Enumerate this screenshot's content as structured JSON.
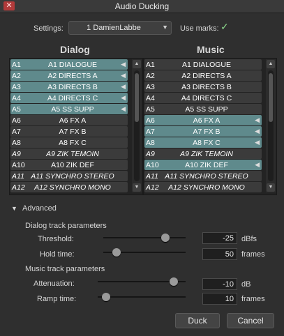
{
  "window": {
    "title": "Audio Ducking",
    "close": "✕"
  },
  "settings": {
    "label": "Settings:",
    "value": "1 DamienLabbe",
    "use_marks_label": "Use marks:",
    "use_marks_checked": true
  },
  "dialog": {
    "title": "Dialog",
    "tracks": [
      {
        "id": "A1",
        "name": "A1 DIALOGUE",
        "selected": true,
        "italic": false
      },
      {
        "id": "A2",
        "name": "A2 DIRECTS A",
        "selected": true,
        "italic": false
      },
      {
        "id": "A3",
        "name": "A3 DIRECTS B",
        "selected": true,
        "italic": false
      },
      {
        "id": "A4",
        "name": "A4 DIRECTS C",
        "selected": true,
        "italic": false
      },
      {
        "id": "A5",
        "name": "A5 SS SUPP",
        "selected": true,
        "italic": false
      },
      {
        "id": "A6",
        "name": "A6 FX A",
        "selected": false,
        "italic": false
      },
      {
        "id": "A7",
        "name": "A7 FX B",
        "selected": false,
        "italic": false
      },
      {
        "id": "A8",
        "name": "A8 FX C",
        "selected": false,
        "italic": false
      },
      {
        "id": "A9",
        "name": "A9 ZIK TEMOIN",
        "selected": false,
        "italic": true
      },
      {
        "id": "A10",
        "name": "A10 ZIK DEF",
        "selected": false,
        "italic": false
      },
      {
        "id": "A11",
        "name": "A11 SYNCHRO STEREO",
        "selected": false,
        "italic": true
      },
      {
        "id": "A12",
        "name": "A12 SYNCHRO MONO",
        "selected": false,
        "italic": true
      }
    ]
  },
  "music": {
    "title": "Music",
    "tracks": [
      {
        "id": "A1",
        "name": "A1 DIALOGUE",
        "selected": false,
        "italic": false
      },
      {
        "id": "A2",
        "name": "A2 DIRECTS A",
        "selected": false,
        "italic": false
      },
      {
        "id": "A3",
        "name": "A3 DIRECTS B",
        "selected": false,
        "italic": false
      },
      {
        "id": "A4",
        "name": "A4 DIRECTS C",
        "selected": false,
        "italic": false
      },
      {
        "id": "A5",
        "name": "A5 SS SUPP",
        "selected": false,
        "italic": false
      },
      {
        "id": "A6",
        "name": "A6 FX A",
        "selected": true,
        "italic": false
      },
      {
        "id": "A7",
        "name": "A7 FX B",
        "selected": true,
        "italic": false
      },
      {
        "id": "A8",
        "name": "A8 FX C",
        "selected": true,
        "italic": false
      },
      {
        "id": "A9",
        "name": "A9 ZIK TEMOIN",
        "selected": false,
        "italic": true
      },
      {
        "id": "A10",
        "name": "A10 ZIK DEF",
        "selected": true,
        "italic": false
      },
      {
        "id": "A11",
        "name": "A11 SYNCHRO STEREO",
        "selected": false,
        "italic": true
      },
      {
        "id": "A12",
        "name": "A12 SYNCHRO MONO",
        "selected": false,
        "italic": true
      }
    ]
  },
  "advanced": {
    "label": "Advanced",
    "dialog_params_label": "Dialog track parameters",
    "threshold": {
      "label": "Threshold:",
      "value": "-25",
      "unit": "dBfs",
      "level": 0.78
    },
    "hold_time": {
      "label": "Hold time:",
      "value": "50",
      "unit": "frames",
      "level": 0.12
    },
    "music_params_label": "Music track parameters",
    "attenuation": {
      "label": "Attenuation:",
      "value": "-10",
      "unit": "dB",
      "level": 0.9
    },
    "ramp_time": {
      "label": "Ramp time:",
      "value": "10",
      "unit": "frames",
      "level": 0.05
    }
  },
  "buttons": {
    "duck": "Duck",
    "cancel": "Cancel"
  },
  "colors": {
    "selected_row": "#5f8a8c",
    "row": "#3b3b3b",
    "close": "#b23a3a"
  }
}
